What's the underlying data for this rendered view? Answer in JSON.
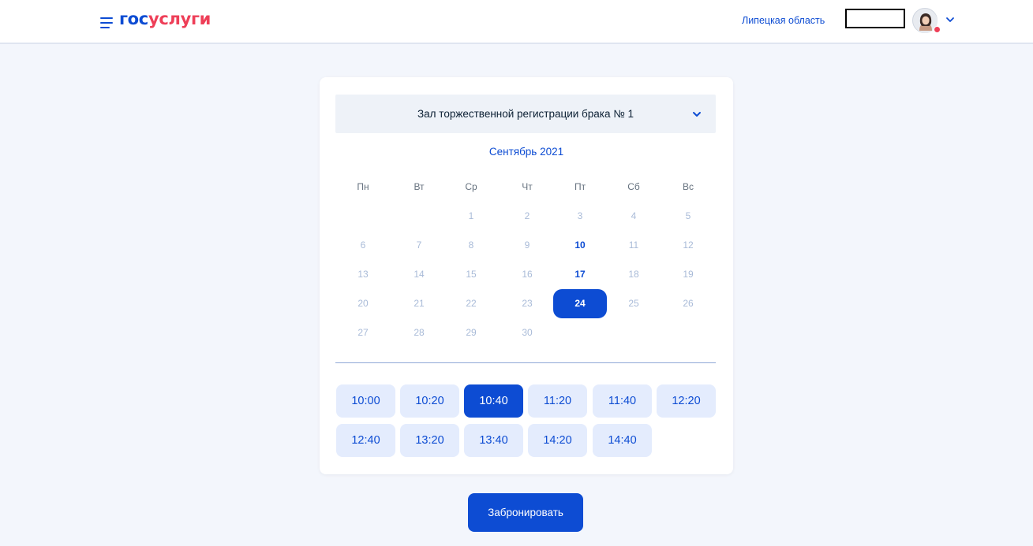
{
  "header": {
    "logo_part1": "гос",
    "logo_part2": "услуги",
    "region": "Липецкая область",
    "menu_icon": "hamburger-menu-icon",
    "avatar_icon": "user-avatar-icon",
    "chevron_icon": "chevron-down-icon"
  },
  "booking": {
    "hall": "Зал торжественной регистрации брака № 1",
    "month": "Сентябрь 2021",
    "weekdays": [
      "Пн",
      "Вт",
      "Ср",
      "Чт",
      "Пт",
      "Сб",
      "Вс"
    ],
    "weeks": [
      [
        "",
        "",
        "1",
        "2",
        "3",
        "4",
        "5"
      ],
      [
        "6",
        "7",
        "8",
        "9",
        "10",
        "11",
        "12"
      ],
      [
        "13",
        "14",
        "15",
        "16",
        "17",
        "18",
        "19"
      ],
      [
        "20",
        "21",
        "22",
        "23",
        "24",
        "25",
        "26"
      ],
      [
        "27",
        "28",
        "29",
        "30",
        "",
        "",
        ""
      ]
    ],
    "available_days": [
      "10",
      "17",
      "24"
    ],
    "selected_day": "24",
    "time_slots": [
      "10:00",
      "10:20",
      "10:40",
      "11:20",
      "11:40",
      "12:20",
      "12:40",
      "13:20",
      "13:40",
      "14:20",
      "14:40"
    ],
    "selected_slot": "10:40",
    "book_button": "Забронировать"
  },
  "colors": {
    "accent": "#0d4cd3",
    "brand_red": "#ee3f58",
    "page_background": "#f3f6fc",
    "slot_background": "#e4ecfd",
    "disabled_day": "#a9bbd8"
  }
}
